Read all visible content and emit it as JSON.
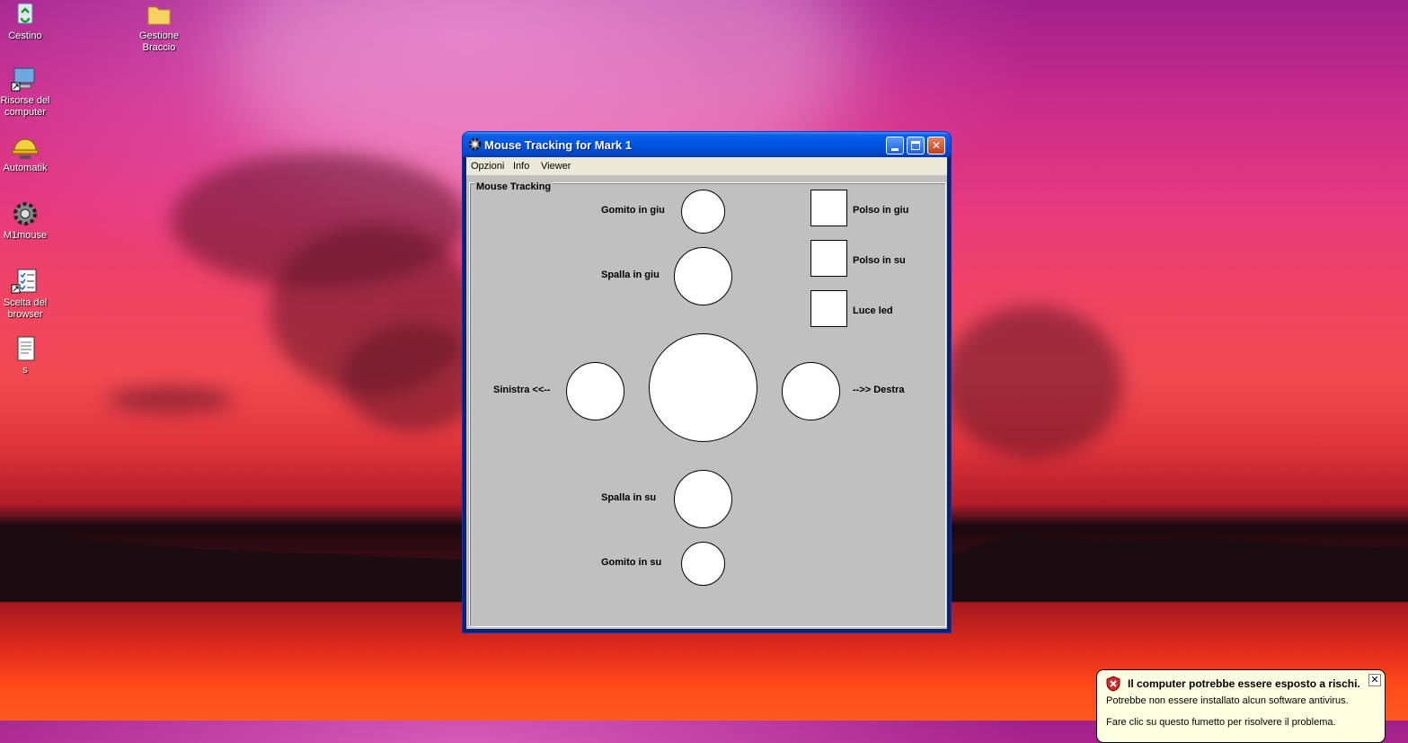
{
  "desktop": {
    "icons": [
      {
        "label": "Cestino",
        "icon": "recycle-bin-icon"
      },
      {
        "label": "Gestione Braccio",
        "icon": "folder-icon"
      },
      {
        "label": "Risorse del computer",
        "icon": "my-computer-icon"
      },
      {
        "label": "Automatik",
        "icon": "hardhat-icon"
      },
      {
        "label": "M1mouse",
        "icon": "gear-icon"
      },
      {
        "label": "Scelta del browser",
        "icon": "checklist-icon"
      },
      {
        "label": "s",
        "icon": "text-document-icon"
      }
    ]
  },
  "window": {
    "title": "Mouse Tracking for Mark 1",
    "menu": [
      "Opzioni",
      "Info",
      "Viewer"
    ],
    "group_title": "Mouse Tracking",
    "controls": {
      "gomito_giu": "Gomito in giu",
      "spalla_giu": "Spalla in giu",
      "sinistra": "Sinistra <<--",
      "destra": "-->> Destra",
      "spalla_su": "Spalla in su",
      "gomito_su": "Gomito in su",
      "polso_giu": "Polso in giu",
      "polso_su": "Polso in su",
      "luce_led": "Luce led"
    }
  },
  "notification": {
    "title": "Il computer potrebbe essere esposto a rischi.",
    "text": "Potrebbe non essere installato alcun software antivirus.",
    "text_partial": "Fare clic su questo fumetto per risolvere il problema.",
    "close": "✕"
  },
  "colors": {
    "titlebar": "#0055e5",
    "panel": "#c0c0c0",
    "menubar": "#ece9d8",
    "balloon": "#ffffe1"
  }
}
